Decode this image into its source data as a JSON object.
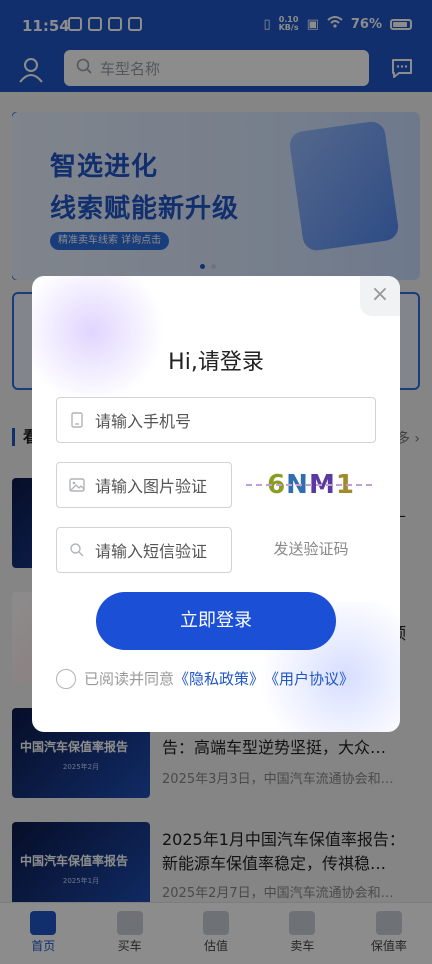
{
  "status": {
    "time": "11:54",
    "speed_value": "0.10",
    "speed_unit": "KB/s",
    "battery": "76%"
  },
  "header": {
    "search_placeholder": "车型名称"
  },
  "banner": {
    "title1": "智选进化",
    "title2": "线索赋能新升级",
    "tag": "精准卖车线索 详询点击"
  },
  "section": {
    "title_frag": "看",
    "more_frag": "多"
  },
  "news": [
    {
      "thumb_title": "",
      "thumb_date": "",
      "title": "",
      "meta": "",
      "right_frag": "—"
    },
    {
      "thumb_title": "",
      "thumb_date": "",
      "title": "",
      "meta": "",
      "right_frag": "顶"
    },
    {
      "thumb_title": "中国汽车保值率报告",
      "thumb_date": "2025年2月",
      "title": "告：高端车型逆势坚挺，大众…",
      "meta": "2025年3月3日，中国汽车流通协会和…"
    },
    {
      "thumb_title": "中国汽车保值率报告",
      "thumb_date": "2025年1月",
      "title": "2025年1月中国汽车保值率报告：新能源车保值率稳定，传祺稳…",
      "meta": "2025年2月7日，中国汽车流通协会和…"
    }
  ],
  "nav": [
    {
      "label": "首页",
      "icon": "home-icon",
      "active": true
    },
    {
      "label": "买车",
      "icon": "car-icon",
      "active": false
    },
    {
      "label": "估值",
      "icon": "estimate-icon",
      "active": false
    },
    {
      "label": "卖车",
      "icon": "sell-tag-icon",
      "active": false
    },
    {
      "label": "保值率",
      "icon": "bar-chart-icon",
      "active": false
    }
  ],
  "modal": {
    "close": "×",
    "title": "Hi,请登录",
    "phone_placeholder": "请输入手机号",
    "image_code_placeholder": "请输入图片验证",
    "captcha": [
      "6",
      "N",
      "M",
      "1"
    ],
    "sms_placeholder": "请输入短信验证",
    "send_code": "发送验证码",
    "login_button": "立即登录",
    "agree_prefix": "已阅读并同意",
    "privacy": "《隐私政策》",
    "user_agreement": "《用户协议》"
  },
  "colors": {
    "brand": "#1f56c7",
    "button": "#1b4fd6"
  }
}
